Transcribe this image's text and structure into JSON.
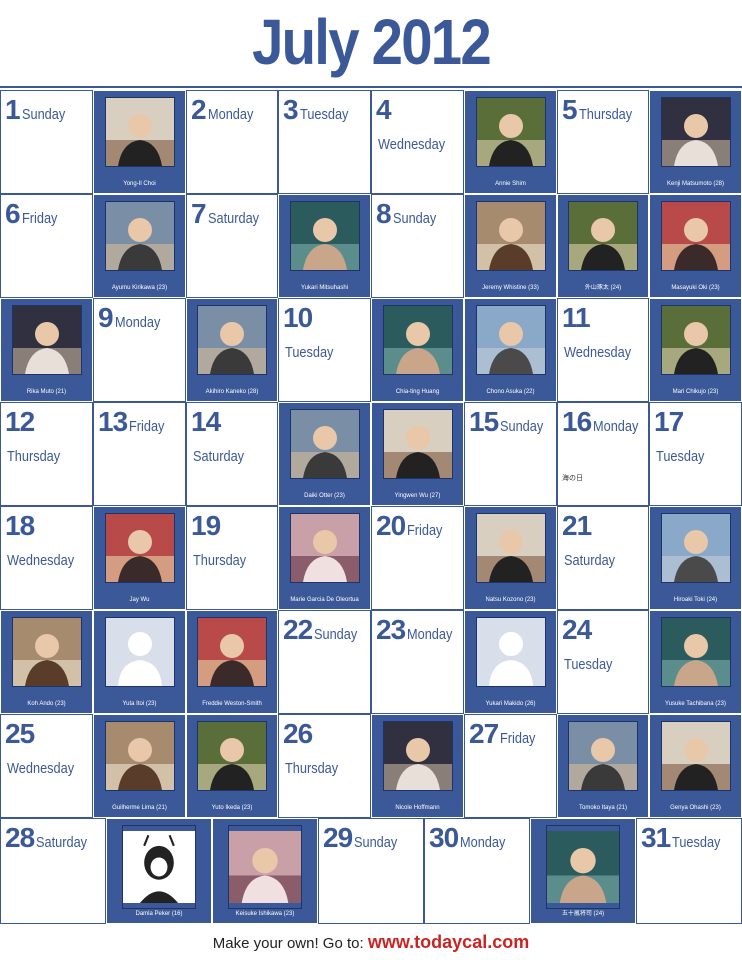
{
  "title": "July 2012",
  "footer": {
    "prefix": "Make your own! Go to:",
    "url": "www.todaycal.com"
  },
  "calendar": {
    "cells": [
      {
        "type": "day",
        "num": "1",
        "wd": "Sunday"
      },
      {
        "type": "photo",
        "caption": "Yong-Il Choi",
        "icon": "person-photo-icon"
      },
      {
        "type": "day",
        "num": "2",
        "wd": "Monday"
      },
      {
        "type": "day",
        "num": "3",
        "wd": "Tuesday"
      },
      {
        "type": "day",
        "num": "4",
        "wd": "Wednesday"
      },
      {
        "type": "photo",
        "caption": "Annie Shim",
        "icon": "person-photo-icon"
      },
      {
        "type": "day",
        "num": "5",
        "wd": "Thursday"
      },
      {
        "type": "photo",
        "caption": "Kenji Matsumoto (28)",
        "icon": "person-photo-icon"
      },
      {
        "type": "day",
        "num": "6",
        "wd": "Friday"
      },
      {
        "type": "photo",
        "caption": "Ayumu Kirikawa (23)",
        "icon": "person-photo-icon"
      },
      {
        "type": "day",
        "num": "7",
        "wd": "Saturday"
      },
      {
        "type": "photo",
        "caption": "Yukari Mitsuhashi",
        "icon": "person-photo-icon"
      },
      {
        "type": "day",
        "num": "8",
        "wd": "Sunday"
      },
      {
        "type": "photo",
        "caption": "Jeremy Whistine (33)",
        "icon": "person-photo-icon"
      },
      {
        "type": "photo",
        "caption": "外山琢太 (24)",
        "icon": "person-photo-icon"
      },
      {
        "type": "photo",
        "caption": "Masayuki Oki (23)",
        "icon": "person-photo-icon"
      },
      {
        "type": "photo",
        "caption": "Rika Muto (21)",
        "icon": "person-photo-icon"
      },
      {
        "type": "day",
        "num": "9",
        "wd": "Monday"
      },
      {
        "type": "photo",
        "caption": "Akihiro Kaneko (28)",
        "icon": "person-photo-icon"
      },
      {
        "type": "day",
        "num": "10",
        "wd": "Tuesday"
      },
      {
        "type": "photo",
        "caption": "Chia-ting Huang",
        "icon": "person-photo-icon"
      },
      {
        "type": "photo",
        "caption": "Chono Asuka (22)",
        "icon": "person-photo-icon"
      },
      {
        "type": "day",
        "num": "11",
        "wd": "Wednesday"
      },
      {
        "type": "photo",
        "caption": "Mari Chikujo (23)",
        "icon": "person-photo-icon"
      },
      {
        "type": "day",
        "num": "12",
        "wd": "Thursday"
      },
      {
        "type": "day",
        "num": "13",
        "wd": "Friday"
      },
      {
        "type": "day",
        "num": "14",
        "wd": "Saturday"
      },
      {
        "type": "photo",
        "caption": "Daiki Otter (23)",
        "icon": "person-photo-icon"
      },
      {
        "type": "photo",
        "caption": "Yingwen Wu (27)",
        "icon": "person-photo-icon"
      },
      {
        "type": "day",
        "num": "15",
        "wd": "Sunday"
      },
      {
        "type": "day",
        "num": "16",
        "wd": "Monday",
        "note": "海の日"
      },
      {
        "type": "day",
        "num": "17",
        "wd": "Tuesday"
      },
      {
        "type": "day",
        "num": "18",
        "wd": "Wednesday"
      },
      {
        "type": "photo",
        "caption": "Jay Wu",
        "icon": "person-photo-icon"
      },
      {
        "type": "day",
        "num": "19",
        "wd": "Thursday"
      },
      {
        "type": "photo",
        "caption": "Marie Garcia De Oleortua",
        "icon": "person-photo-icon"
      },
      {
        "type": "day",
        "num": "20",
        "wd": "Friday"
      },
      {
        "type": "photo",
        "caption": "Natsu Kozono (23)",
        "icon": "person-photo-icon"
      },
      {
        "type": "day",
        "num": "21",
        "wd": "Saturday"
      },
      {
        "type": "photo",
        "caption": "Hiroaki Toki (24)",
        "icon": "person-photo-icon"
      },
      {
        "type": "photo",
        "caption": "Koh Ando (23)",
        "icon": "person-photo-icon"
      },
      {
        "type": "photo",
        "caption": "Yuta Itoi (23)",
        "icon": "default-avatar-icon"
      },
      {
        "type": "photo",
        "caption": "Freddie Weston-Smith",
        "icon": "person-photo-icon"
      },
      {
        "type": "day",
        "num": "22",
        "wd": "Sunday"
      },
      {
        "type": "day",
        "num": "23",
        "wd": "Monday"
      },
      {
        "type": "photo",
        "caption": "Yukari Makido (26)",
        "icon": "default-avatar-icon"
      },
      {
        "type": "day",
        "num": "24",
        "wd": "Tuesday"
      },
      {
        "type": "photo",
        "caption": "Yusuke Tachibana (23)",
        "icon": "person-photo-icon"
      },
      {
        "type": "day",
        "num": "25",
        "wd": "Wednesday"
      },
      {
        "type": "photo",
        "caption": "Guilherme Lima (21)",
        "icon": "person-photo-icon"
      },
      {
        "type": "photo",
        "caption": "Yuto Ikeda (23)",
        "icon": "person-photo-icon"
      },
      {
        "type": "day",
        "num": "26",
        "wd": "Thursday"
      },
      {
        "type": "photo",
        "caption": "Nicole Hoffmann",
        "icon": "person-photo-icon"
      },
      {
        "type": "day",
        "num": "27",
        "wd": "Friday"
      },
      {
        "type": "photo",
        "caption": "Tomoko Itaya (21)",
        "icon": "person-photo-icon"
      },
      {
        "type": "photo",
        "caption": "Genya Ohashi (23)",
        "icon": "person-photo-icon"
      }
    ],
    "last_row": [
      {
        "type": "day",
        "num": "28",
        "wd": "Saturday"
      },
      {
        "type": "photo",
        "caption": "Damla Peker (16)",
        "icon": "cartoon-photo-icon"
      },
      {
        "type": "photo",
        "caption": "Keisuke Ishikawa (23)",
        "icon": "person-photo-icon"
      },
      {
        "type": "day",
        "num": "29",
        "wd": "Sunday"
      },
      {
        "type": "day",
        "num": "30",
        "wd": "Monday"
      },
      {
        "type": "photo",
        "caption": "五十嵐将司 (24)",
        "icon": "person-photo-icon"
      },
      {
        "type": "day",
        "num": "31",
        "wd": "Tuesday"
      }
    ]
  },
  "colors": {
    "brand_blue": "#3b5998",
    "link_red": "#cc2222"
  }
}
